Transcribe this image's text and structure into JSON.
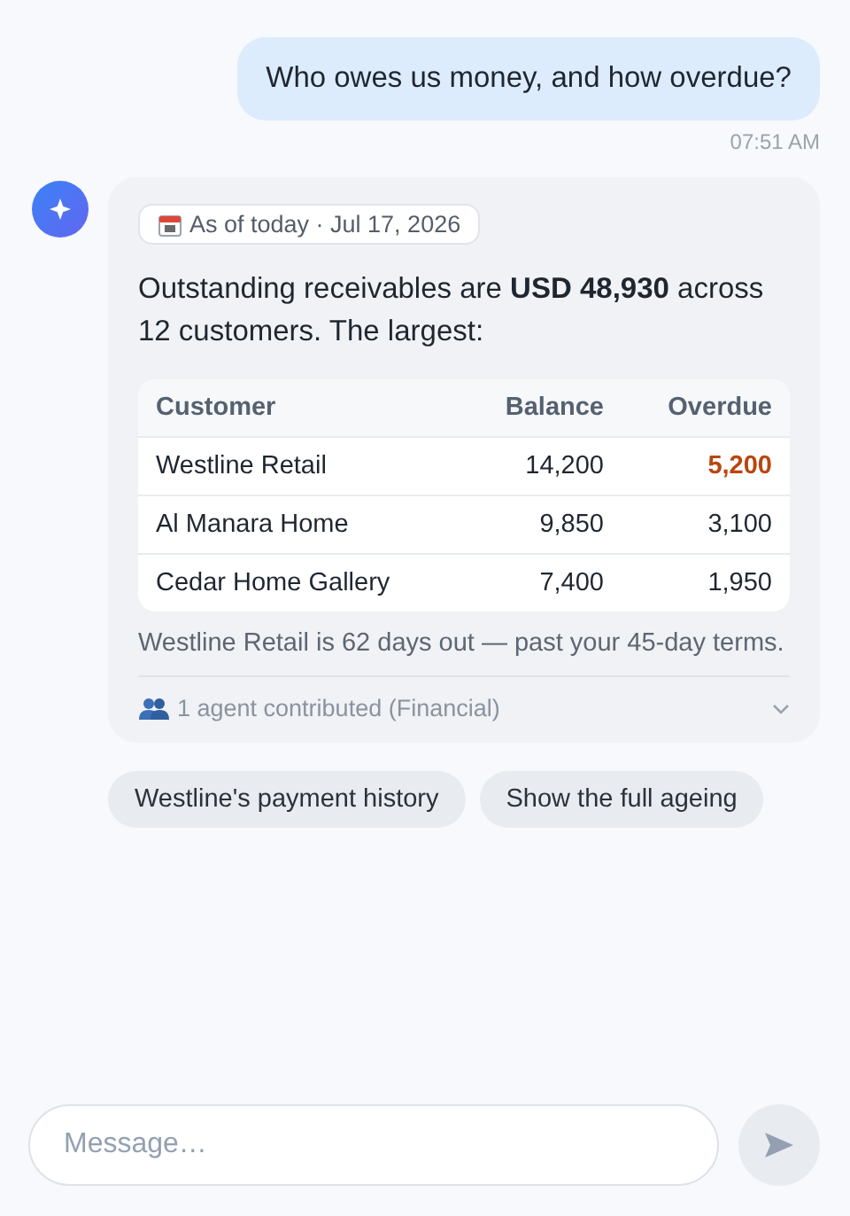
{
  "user_message": {
    "text": "Who owes us money, and how overdue?",
    "time": "07:51 AM"
  },
  "reply": {
    "date_chip": "As of today · Jul 17, 2026",
    "intro": "Outstanding receivables are **USD 48,930** across 12 customers. The largest:",
    "table": {
      "columns": [
        "Customer",
        "Balance",
        "Overdue"
      ],
      "rows": [
        {
          "customer": "Westline Retail",
          "balance": "14,200",
          "overdue": "5,200",
          "alert": true
        },
        {
          "customer": "Al Manara Home",
          "balance": "9,850",
          "overdue": "3,100",
          "alert": false
        },
        {
          "customer": "Cedar Home Gallery",
          "balance": "7,400",
          "overdue": "1,950",
          "alert": false
        }
      ]
    },
    "note": "Westline Retail is 62 days out — past your 45-day terms.",
    "agents": {
      "text": "1 agent contributed (Financial)",
      "expanded": false
    }
  },
  "suggestions": [
    "Westline's payment history",
    "Show the full ageing"
  ],
  "composer": {
    "placeholder": "Message…"
  }
}
